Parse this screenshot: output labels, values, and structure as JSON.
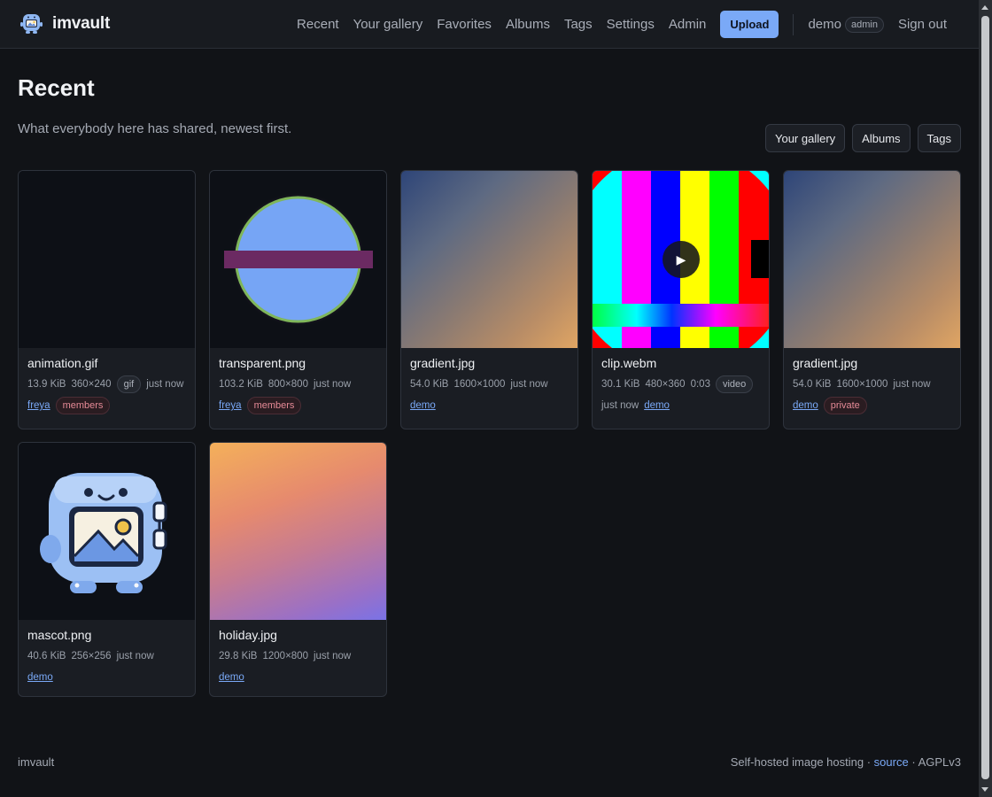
{
  "app": {
    "name": "imvault"
  },
  "nav": {
    "items": [
      "Recent",
      "Your gallery",
      "Favorites",
      "Albums",
      "Tags",
      "Settings",
      "Admin"
    ],
    "upload_label": "Upload",
    "user": "demo",
    "role": "admin",
    "signout_label": "Sign out"
  },
  "page": {
    "title": "Recent",
    "subtitle": "What everybody here has shared, newest first.",
    "quick_links": [
      "Your gallery",
      "Albums",
      "Tags"
    ]
  },
  "cards": [
    {
      "name": "animation.gif",
      "size": "13.9 KiB",
      "dims": "360×240",
      "badge": "gif",
      "time": "just now",
      "owner": "freya",
      "visibility": "members"
    },
    {
      "name": "transparent.png",
      "size": "103.2 KiB",
      "dims": "800×800",
      "time": "just now",
      "owner": "freya",
      "visibility": "members"
    },
    {
      "name": "gradient.jpg",
      "size": "54.0 KiB",
      "dims": "1600×1000",
      "time": "just now",
      "owner": "demo"
    },
    {
      "name": "clip.webm",
      "size": "30.1 KiB",
      "dims": "480×360",
      "duration": "0:03",
      "badge": "video",
      "time": "just now",
      "owner": "demo"
    },
    {
      "name": "gradient.jpg",
      "size": "54.0 KiB",
      "dims": "1600×1000",
      "time": "just now",
      "owner": "demo",
      "visibility": "private"
    },
    {
      "name": "mascot.png",
      "size": "40.6 KiB",
      "dims": "256×256",
      "time": "just now",
      "owner": "demo"
    },
    {
      "name": "holiday.jpg",
      "size": "29.8 KiB",
      "dims": "1200×800",
      "time": "just now",
      "owner": "demo"
    }
  ],
  "footer": {
    "left": "imvault",
    "tagline": "Self-hosted image hosting",
    "link": "source",
    "license": "AGPLv3"
  },
  "colors": {
    "accent": "#7aa9f7",
    "background": "#111317",
    "card": "#1a1d23",
    "private": "#e58a96"
  }
}
